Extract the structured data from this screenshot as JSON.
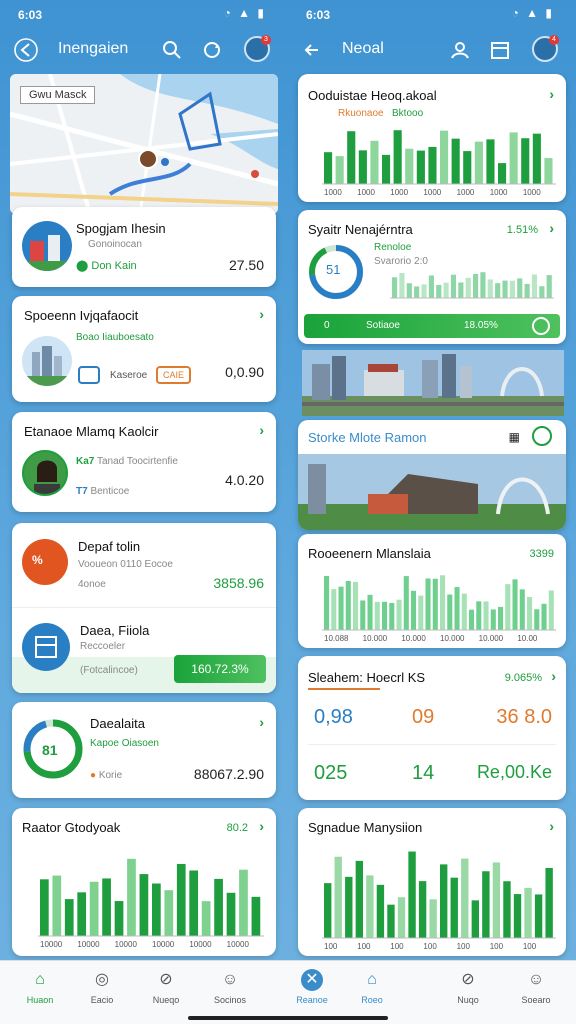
{
  "left": {
    "status": {
      "time": "6:03",
      "icons": "▾◢▮"
    },
    "appbar": {
      "title": "Inengaien",
      "back_icon": "back-arrow-icon",
      "badge": "3"
    },
    "map": {
      "tag": "Gwu Masck"
    },
    "cards": [
      {
        "title": "Spogjam Ihesin",
        "sub": "Gonoinocan",
        "loc": "Don Kain",
        "value": "27.50"
      },
      {
        "title": "Spoeenn Ivjqafaocit",
        "sub": "Boao Iiauboesato",
        "tag1": "Kaseroe",
        "tag2": "CAIE",
        "value": "0,0.90"
      },
      {
        "title": "Etanaoe Mlamq Kaolcir",
        "line1": "Tanad Toocirtenfie",
        "line2": "Benticoe",
        "prefix1": "Ka7",
        "prefix2": "T7",
        "value": "4.0.20"
      },
      {
        "title": "Depaf tolin",
        "sub": "Vooueon 0110 Eocoe",
        "sub2": "4onoe",
        "value": "3858.96"
      },
      {
        "title": "Daea, Fiiola",
        "sub": "Reccoeler",
        "sub2": "(Fotcalincoe)",
        "button": "160.72.3%"
      },
      {
        "title": "Daealaita",
        "sub": "Kapoe Oiasoen",
        "loc": "Korie",
        "ring": "81",
        "value": "88067.2.90"
      },
      {
        "title": "Raator Gtodyoak",
        "value": "80.2"
      }
    ],
    "chart": {
      "ticks": [
        "15",
        "10",
        "100",
        "5",
        "5"
      ],
      "xlabels": [
        "10000",
        "10000",
        "10000",
        "10000",
        "10000",
        "10000"
      ]
    }
  },
  "right": {
    "status": {
      "time": "6:03",
      "icons": "▾◢▮"
    },
    "appbar": {
      "title": "Neoal",
      "badge": "4"
    },
    "cards": [
      {
        "title": "Ooduistae Heoq.akoal",
        "legend1": "Rkuonaoe",
        "legend2": "Bktooo",
        "yticks": [
          "100",
          "100",
          "100",
          "100"
        ],
        "xlabels": [
          "1000",
          "1000",
          "1000",
          "1000",
          "1000",
          "1000",
          "1000"
        ]
      },
      {
        "title": "Syaitr Nenajérntra",
        "pct": "1.51%",
        "ring": "51",
        "sub1": "Renoloe",
        "sub2": "Svarorio 2:0"
      },
      {
        "title": "Sotiaoe",
        "left": "0",
        "value": "18.05%"
      },
      {
        "title": "Storke Mlote Ramon"
      },
      {
        "title": "Rooeenern Mlanslaia",
        "pct": "3399",
        "xlabels": [
          "10.088",
          "10.000",
          "10.000",
          "10.000",
          "10.000",
          "10.00"
        ]
      },
      {
        "title": "Sleahem: Hoecrl KS",
        "pct": "9.065%",
        "n1": "0,98",
        "n2": "09",
        "n3": "36 8.0",
        "n4": "025",
        "n5": "14",
        "n6": "Re,00.Ke"
      },
      {
        "title": "Sgnadue Manysiion",
        "xlabels": [
          "100",
          "100",
          "100",
          "100",
          "100",
          "100",
          "100"
        ]
      }
    ]
  },
  "bottomnav": {
    "left": [
      "Huaon",
      "Eacio",
      "Nueqo",
      "Socinos"
    ],
    "right": [
      "Reanoe",
      "Roeo",
      "Nuqo",
      "Soearo"
    ]
  },
  "colors": {
    "green": "#1e9e3e",
    "blue": "#3f93d2",
    "orange": "#e07b2e"
  }
}
